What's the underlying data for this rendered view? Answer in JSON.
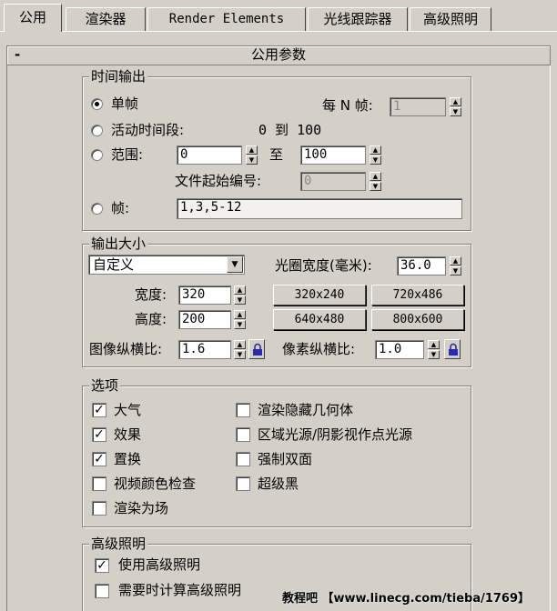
{
  "tabs": [
    "公用",
    "渲染器",
    "Render Elements",
    "光线跟踪器",
    "高级照明"
  ],
  "rollout": {
    "toggle": "-",
    "title": "公用参数"
  },
  "time_output": {
    "legend": "时间输出",
    "single": "单帧",
    "every_n_label": "每 N 帧:",
    "every_n_value": "1",
    "active_segment": "活动时间段:",
    "active_range": "0 到 100",
    "range": "范围:",
    "range_from": "0",
    "range_to_label": "至",
    "range_to": "100",
    "file_number_base_label": "文件起始编号:",
    "file_number_base": "0",
    "frames": "帧:",
    "frames_value": "1,3,5-12"
  },
  "output_size": {
    "legend": "输出大小",
    "preset": "自定义",
    "aperture_label": "光圈宽度(毫米):",
    "aperture_value": "36.0",
    "width_label": "宽度:",
    "width_value": "320",
    "height_label": "高度:",
    "height_value": "200",
    "presets": [
      "320x240",
      "720x486",
      "640x480",
      "800x600"
    ],
    "image_aspect_label": "图像纵横比:",
    "image_aspect_value": "1.6",
    "pixel_aspect_label": "像素纵横比:",
    "pixel_aspect_value": "1.0"
  },
  "options": {
    "legend": "选项",
    "atmospherics": "大气",
    "effects": "效果",
    "displacement": "置换",
    "video_color_check": "视频颜色检查",
    "render_to_fields": "渲染为场",
    "render_hidden": "渲染隐藏几何体",
    "area_lights": "区域光源/阴影视作点光源",
    "force_2sided": "强制双面",
    "super_black": "超级黑"
  },
  "advanced_lighting": {
    "legend": "高级照明",
    "use": "使用高级照明",
    "compute_when_required": "需要时计算高级照明"
  },
  "watermark": "教程吧 【www.linecg.com/tieba/1769】",
  "icons": {
    "lock": "lock-icon",
    "dropdown": "chevron-down-icon",
    "spinner": "spinner-arrows-icon"
  }
}
